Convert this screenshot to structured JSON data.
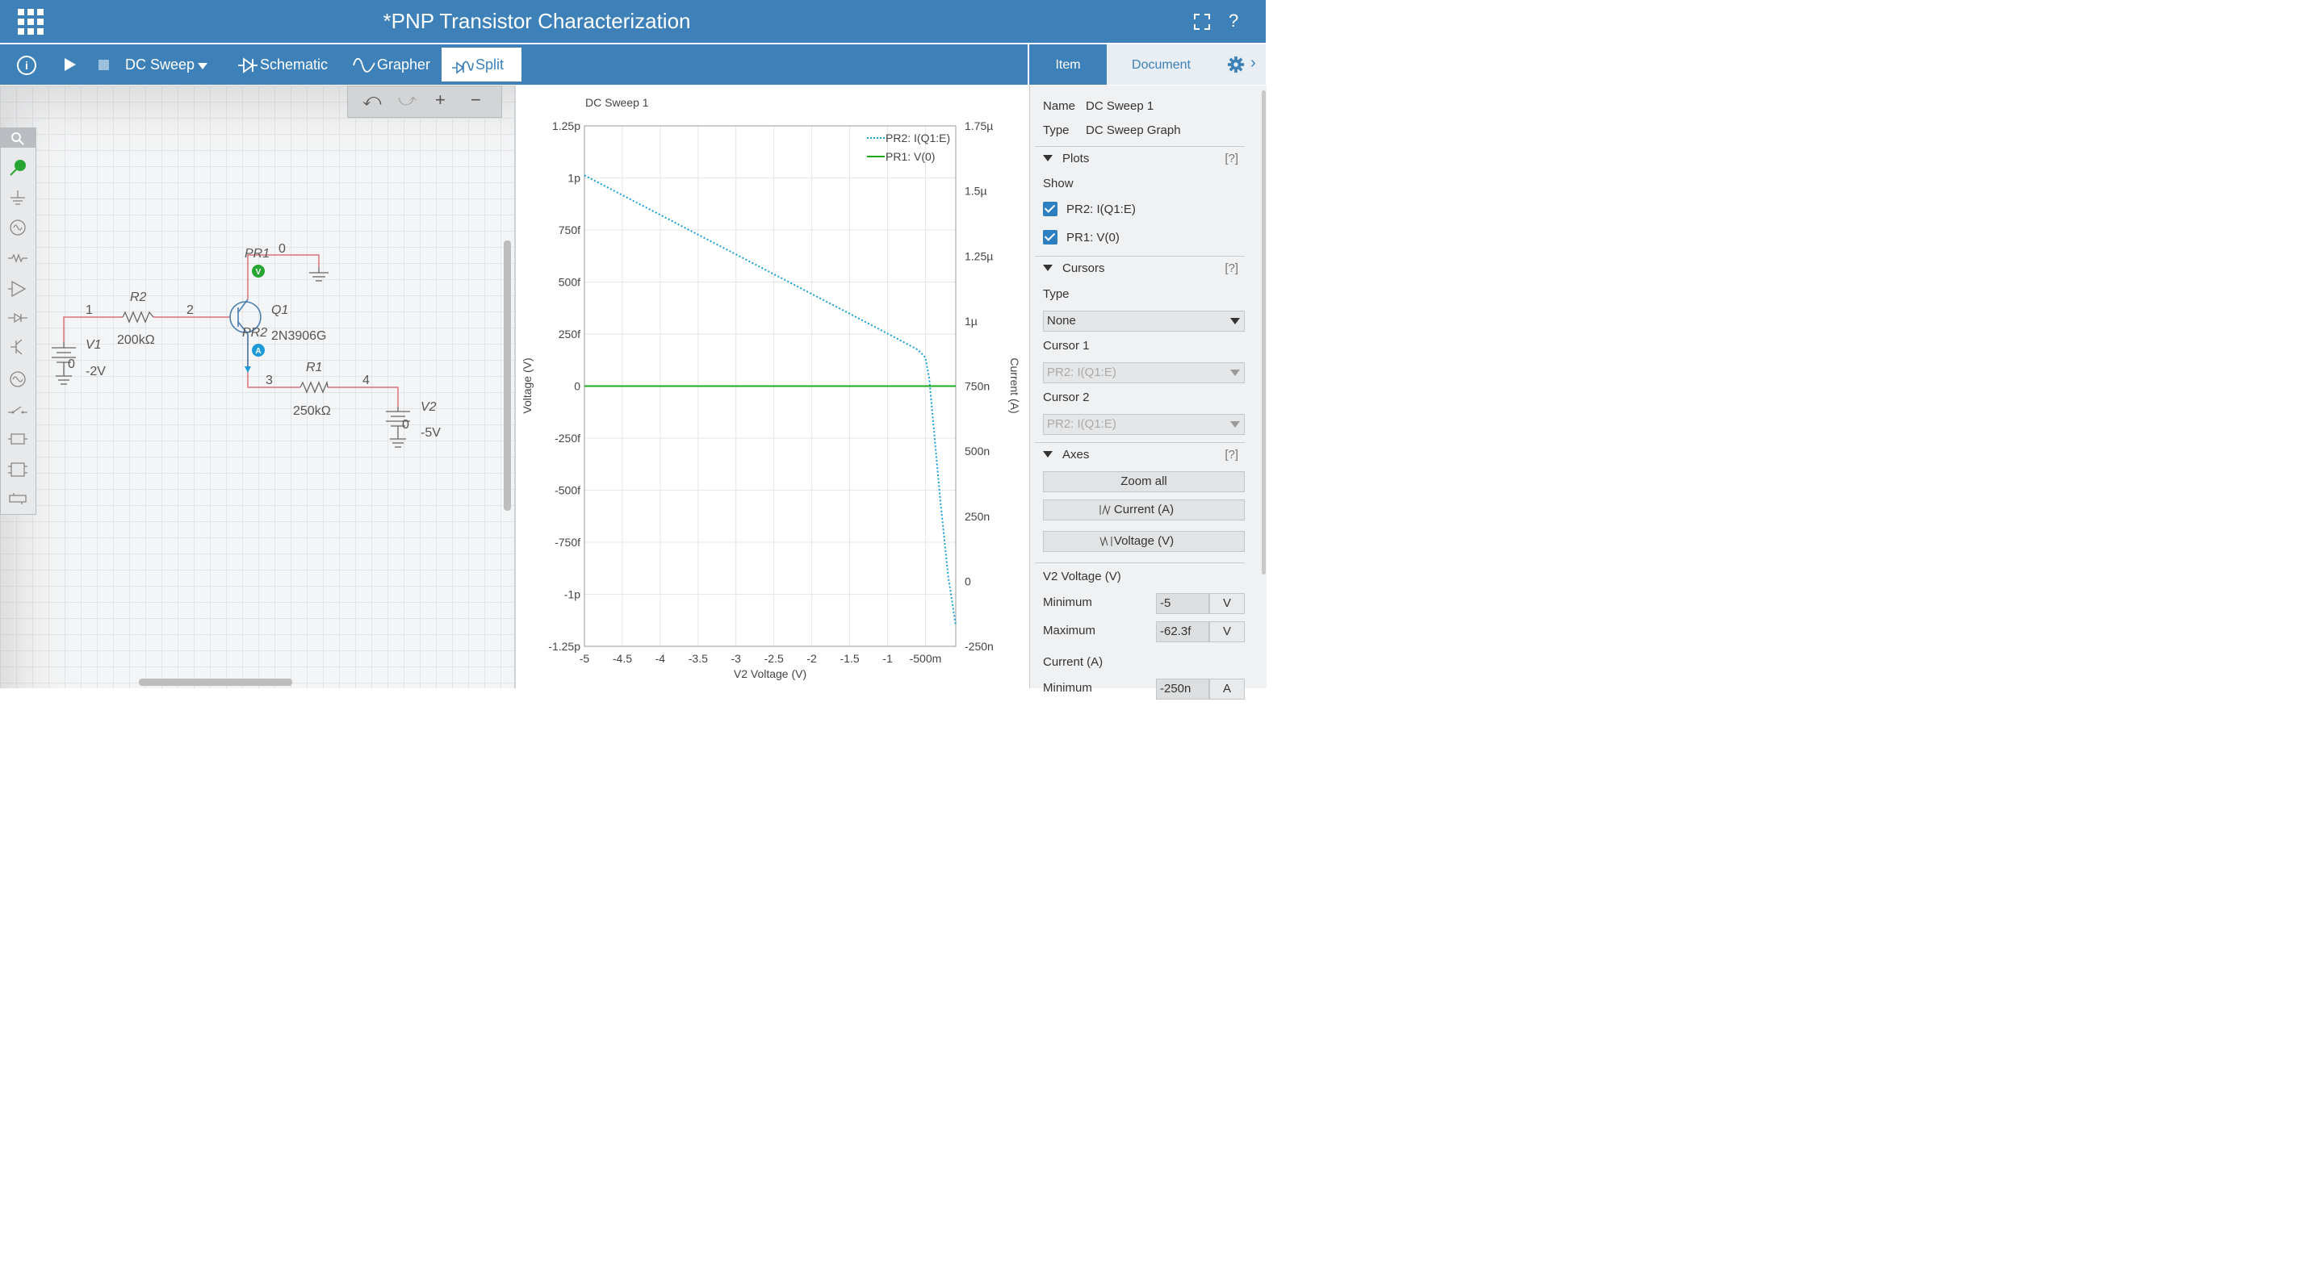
{
  "window": {
    "title": "*PNP Transistor Characterization",
    "help": "?"
  },
  "toolbar": {
    "info_icon": "i",
    "mode": "DC Sweep",
    "tabs": [
      {
        "label": "Schematic",
        "icon": "diode-icon"
      },
      {
        "label": "Grapher",
        "icon": "sine-icon"
      },
      {
        "label": "Split",
        "icon": "split-icon",
        "active": true
      }
    ]
  },
  "panel_tabs": {
    "item": "Item",
    "document": "Document"
  },
  "schematic": {
    "edit_tools": {
      "undo": "⤺",
      "redo": "⤻",
      "zoom_in": "+",
      "zoom_out": "−"
    },
    "palette_icons": [
      "search-icon",
      "voltage-probe-icon",
      "ground-icon",
      "ac-source-icon",
      "resistor-icon",
      "opamp-icon",
      "diode-icon",
      "transistor-icon",
      "meter-icon",
      "switch-icon",
      "subcircuit-icon",
      "ic-icon",
      "connector-icon"
    ],
    "labels": {
      "pr1": "PR1",
      "pr2": "PR2",
      "probe_v": "V",
      "probe_a": "A",
      "q1": "Q1",
      "q1_model": "2N3906G",
      "r2": "R2",
      "r2_value": "200kΩ",
      "r1": "R1",
      "r1_value": "250kΩ",
      "v1": "V1",
      "v1_value": "-2V",
      "v1_zero": "0",
      "v2": "V2",
      "v2_value": "-5V",
      "v2_zero": "0",
      "node0": "0",
      "node1": "1",
      "node2": "2",
      "node3": "3",
      "node4": "4"
    },
    "colors": {
      "wire": "#d9737c",
      "device": "#4a7fb0",
      "probe_v": "#27a533",
      "probe_a": "#1e9bd7"
    }
  },
  "chart_data": {
    "type": "line",
    "title": "DC Sweep 1",
    "xlabel": "V2 Voltage (V)",
    "ylabel": "Voltage (V)",
    "y2label": "Current (A)",
    "xlim": [
      -5,
      -0.1
    ],
    "x_ticks": [
      "-5",
      "-4.5",
      "-4",
      "-3.5",
      "-3",
      "-2.5",
      "-2",
      "-1.5",
      "-1",
      "-500m"
    ],
    "y_ticks": [
      "1.25p",
      "1p",
      "750f",
      "500f",
      "250f",
      "0",
      "-250f",
      "-500f",
      "-750f",
      "-1p",
      "-1.25p"
    ],
    "y2_ticks": [
      "1.75µ",
      "1.5µ",
      "1.25µ",
      "1µ",
      "750n",
      "500n",
      "250n",
      "0",
      "-250n"
    ],
    "ylim": [
      -1.25e-12,
      1.25e-12
    ],
    "y2lim": [
      -2.5e-07,
      1.75e-06
    ],
    "legend": "top-right",
    "series": [
      {
        "name": "PR2: I(Q1:E)",
        "axis": "right",
        "color": "#1a9fd6",
        "style": "dotted",
        "x": [
          -5,
          -4.5,
          -4,
          -3.5,
          -3,
          -2.5,
          -2,
          -1.5,
          -1,
          -0.6,
          -0.5,
          -0.45,
          -0.4,
          -0.3,
          -0.2,
          -0.1
        ],
        "y": [
          1.56e-06,
          1.484e-06,
          1.408e-06,
          1.332e-06,
          1.256e-06,
          1.18e-06,
          1.104e-06,
          1.028e-06,
          9.52e-07,
          8.9e-07,
          8.6e-07,
          7.8e-07,
          6.2e-07,
          3e-07,
          2e-08,
          -1.7e-07
        ]
      },
      {
        "name": "PR1: V(0)",
        "axis": "left",
        "color": "#1faa1f",
        "style": "solid",
        "x": [
          -5,
          -0.1
        ],
        "y": [
          0,
          0
        ]
      }
    ]
  },
  "props": {
    "name_label": "Name",
    "name_value": "DC Sweep 1",
    "type_label": "Type",
    "type_value": "DC Sweep Graph",
    "plots": {
      "title": "Plots",
      "help": "[?]",
      "show_label": "Show",
      "items": [
        {
          "label": "PR2: I(Q1:E)",
          "checked": true
        },
        {
          "label": "PR1: V(0)",
          "checked": true
        }
      ]
    },
    "cursors": {
      "title": "Cursors",
      "help": "[?]",
      "type_label": "Type",
      "type_value": "None",
      "cursor1_label": "Cursor 1",
      "cursor1_value": "PR2: I(Q1:E)",
      "cursor2_label": "Cursor 2",
      "cursor2_value": "PR2: I(Q1:E)"
    },
    "axes": {
      "title": "Axes",
      "help": "[?]",
      "zoom_all": "Zoom all",
      "current_btn": "Current (A)",
      "voltage_btn": "Voltage (V)"
    },
    "v2": {
      "title": "V2 Voltage (V)",
      "min_label": "Minimum",
      "min_value": "-5",
      "min_unit": "V",
      "max_label": "Maximum",
      "max_value": "-62.3f",
      "max_unit": "V"
    },
    "current": {
      "title": "Current (A)",
      "min_label": "Minimum",
      "min_value": "-250n",
      "min_unit": "A"
    }
  }
}
